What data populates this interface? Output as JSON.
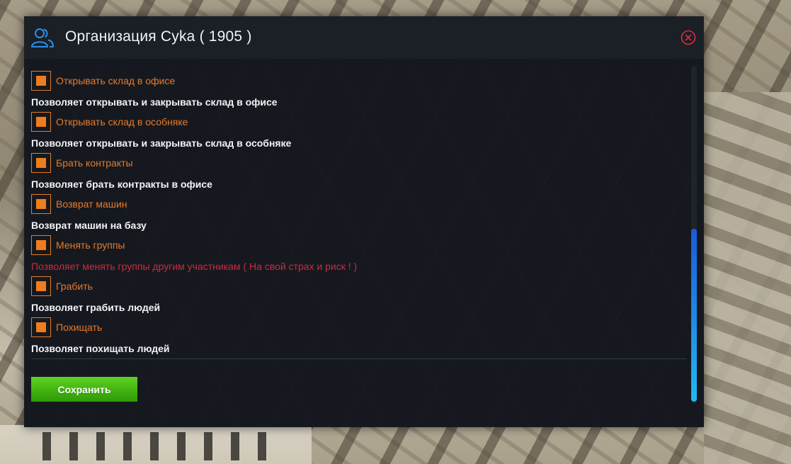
{
  "window": {
    "title": "Организация Cyka ( 1905 )",
    "title_icon": "users-icon",
    "close_icon": "close-circle-icon"
  },
  "colors": {
    "accent_orange": "#f07d1c",
    "warning_red": "#cc2a3e",
    "save_green": "#3fb00e",
    "scroll_blue": "#1f8de6"
  },
  "permissions": [
    {
      "label": "Открывать склад в офисе",
      "description": "Позволяет открывать и закрывать склад в офисе",
      "warning": false,
      "checked": true
    },
    {
      "label": "Открывать склад в особняке",
      "description": "Позволяет открывать и закрывать склад в особняке",
      "warning": false,
      "checked": true
    },
    {
      "label": "Брать контракты",
      "description": "Позволяет брать контракты в офисе",
      "warning": false,
      "checked": true
    },
    {
      "label": "Возврат машин",
      "description": "Возврат машин на базу",
      "warning": false,
      "checked": true
    },
    {
      "label": "Менять группы",
      "description": "Позволяет менять группы другим участникам ( На свой страх и риск ! )",
      "warning": true,
      "checked": true
    },
    {
      "label": "Грабить",
      "description": "Позволяет грабить людей",
      "warning": false,
      "checked": true
    },
    {
      "label": "Похищать",
      "description": "Позволяет похищать людей",
      "warning": false,
      "checked": true
    }
  ],
  "footer": {
    "save_label": "Сохранить"
  }
}
